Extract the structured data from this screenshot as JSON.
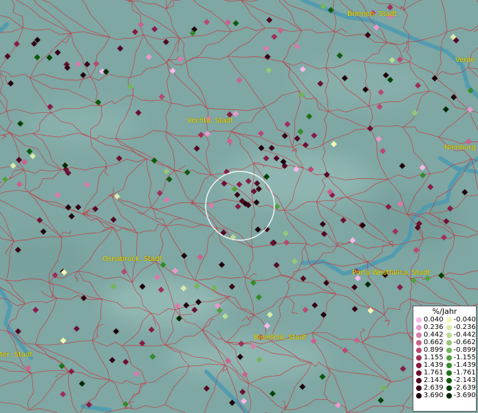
{
  "cities": [
    {
      "id": "bremen",
      "label": "Bremen, Stadt"
    },
    {
      "id": "verden",
      "label": "Verde"
    },
    {
      "id": "vechta",
      "label": "Vechta, Stadt"
    },
    {
      "id": "nienburg",
      "label": "Nienburg ("
    },
    {
      "id": "osnabrueck",
      "label": "Osnabrück, Stadt"
    },
    {
      "id": "porta",
      "label": "Porta Westfalica, Stadt"
    },
    {
      "id": "bielefeld",
      "label": "Bielefeld, Stadt"
    },
    {
      "id": "westcity",
      "label": "ter, Stadt"
    }
  ],
  "legend": {
    "title": "%/Jahr",
    "positive": [
      {
        "value": "0.040",
        "color": "#f7b8ea"
      },
      {
        "value": "0.236",
        "color": "#e79acc"
      },
      {
        "value": "0.442",
        "color": "#d97bab"
      },
      {
        "value": "0.662",
        "color": "#c9628f"
      },
      {
        "value": "0.899",
        "color": "#b64a72"
      },
      {
        "value": "1.155",
        "color": "#9e2f58"
      },
      {
        "value": "1.439",
        "color": "#861d45"
      },
      {
        "value": "1.761",
        "color": "#6b1133"
      },
      {
        "value": "2.143",
        "color": "#520823"
      },
      {
        "value": "2.639",
        "color": "#380316"
      },
      {
        "value": "3.690",
        "color": "#1e000b"
      }
    ],
    "negative": [
      {
        "value": "-0.040",
        "color": "#f4f7b4"
      },
      {
        "value": "-0.236",
        "color": "#d8ebac"
      },
      {
        "value": "-0.442",
        "color": "#b7dc95"
      },
      {
        "value": "-0.662",
        "color": "#95c878"
      },
      {
        "value": "-0.899",
        "color": "#73b55a"
      },
      {
        "value": "-1.155",
        "color": "#52a03f"
      },
      {
        "value": "-1.439",
        "color": "#368a2b"
      },
      {
        "value": "-1.761",
        "color": "#207219"
      },
      {
        "value": "-2.143",
        "color": "#0f5a0e"
      },
      {
        "value": "-2.639",
        "color": "#054106"
      },
      {
        "value": "-3.690",
        "color": "#002802"
      }
    ]
  },
  "colors": {
    "background": "#7fa7a3",
    "river": "#4f9bb1",
    "borders": "#c8323a",
    "city_label": "#f2e000",
    "highlight_circle": "#ffffff"
  }
}
